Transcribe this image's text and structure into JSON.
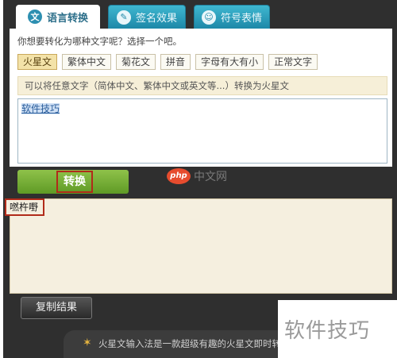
{
  "tabs": [
    {
      "label": "语言转换",
      "icon": "translate-icon"
    },
    {
      "label": "签名效果",
      "icon": "edit-icon"
    },
    {
      "label": "符号表情",
      "icon": "smiley-icon"
    }
  ],
  "panel": {
    "question": "你想要转化为哪种文字呢？选择一个吧。",
    "types": [
      "火星文",
      "繁体中文",
      "菊花文",
      "拼音",
      "字母有大有小",
      "正常文字"
    ],
    "active_type": "火星文",
    "hint": "可以将任意文字（简体中文、繁体中文或英文等...）转换为火星文",
    "input_value": "软件技巧"
  },
  "convert": {
    "label": "转换"
  },
  "result": {
    "value": "嘫杵嘢"
  },
  "copy": {
    "label": "复制结果"
  },
  "footer": {
    "text": "火星文输入法是一款超级有趣的火星文即时转换"
  },
  "watermarks": {
    "php": "php",
    "php_cn": "中文网",
    "corner": "软件技巧"
  },
  "colors": {
    "tab_blue": "#1d88a8",
    "convert_green": "#6fa82f",
    "highlight_red": "#b12b1a",
    "result_bg": "#f5efdf"
  }
}
